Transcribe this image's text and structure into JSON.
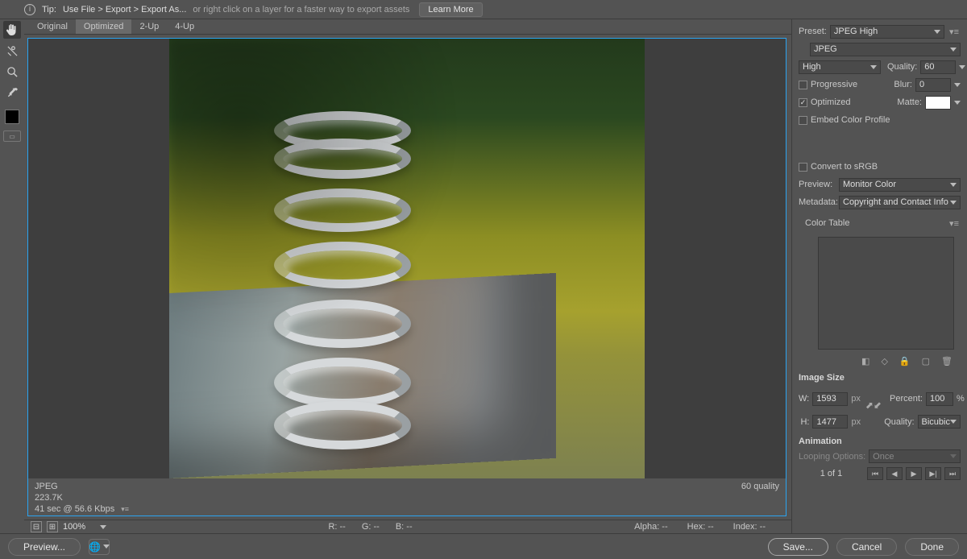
{
  "tip": {
    "prefix": "Tip:",
    "path": "Use File > Export > Export As...",
    "suffix": "or right click on a layer for a faster way to export assets",
    "learn_more": "Learn More"
  },
  "tabs": [
    "Original",
    "Optimized",
    "2-Up",
    "4-Up"
  ],
  "active_tab": "Optimized",
  "tools": [
    "hand",
    "slice",
    "zoom",
    "eyedropper"
  ],
  "canvas": {
    "format": "JPEG",
    "size": "223.7K",
    "transfer": "41 sec @ 56.6 Kbps",
    "quality_badge": "60 quality"
  },
  "readout": {
    "zoom": "100%",
    "R": "R: --",
    "G": "G: --",
    "B": "B: --",
    "Alpha": "Alpha: --",
    "Hex": "Hex: --",
    "Index": "Index: --"
  },
  "panel": {
    "preset_label": "Preset:",
    "preset": "JPEG High",
    "format": "JPEG",
    "quality_select": "High",
    "quality_label": "Quality:",
    "quality_value": "60",
    "progressive": "Progressive",
    "blur_label": "Blur:",
    "blur_value": "0",
    "optimized": "Optimized",
    "matte_label": "Matte:",
    "embed": "Embed Color Profile",
    "convert_srgb": "Convert to sRGB",
    "preview_label": "Preview:",
    "preview": "Monitor Color",
    "metadata_label": "Metadata:",
    "metadata": "Copyright and Contact Info",
    "color_table": "Color Table",
    "image_size": "Image Size",
    "W": "W:",
    "width": "1593",
    "H": "H:",
    "height": "1477",
    "unit": "px",
    "percent_label": "Percent:",
    "percent_value": "100",
    "percent_unit": "%",
    "quality2_label": "Quality:",
    "quality2": "Bicubic",
    "animation": "Animation",
    "looping_label": "Looping Options:",
    "looping": "Once",
    "frame": "1 of 1"
  },
  "footer": {
    "preview": "Preview...",
    "save": "Save...",
    "cancel": "Cancel",
    "done": "Done"
  }
}
